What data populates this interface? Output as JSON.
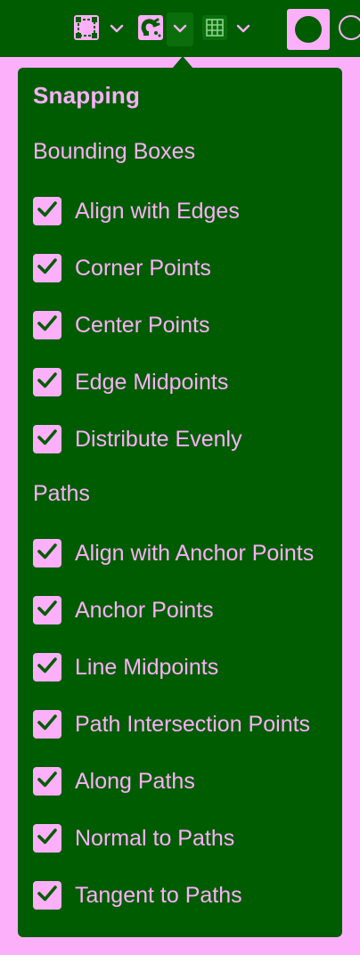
{
  "toolbar": {
    "icons": [
      "bounding-box-snap-icon",
      "magnet-snap-icon",
      "grid-icon"
    ],
    "primary_color": "#005C00",
    "secondary_color": "#FDB0FA"
  },
  "panel": {
    "title": "Snapping",
    "sections": [
      {
        "label": "Bounding Boxes",
        "items": [
          {
            "label": "Align with Edges",
            "checked": true
          },
          {
            "label": "Corner Points",
            "checked": true
          },
          {
            "label": "Center Points",
            "checked": true
          },
          {
            "label": "Edge Midpoints",
            "checked": true
          },
          {
            "label": "Distribute Evenly",
            "checked": true
          }
        ]
      },
      {
        "label": "Paths",
        "items": [
          {
            "label": "Align with Anchor Points",
            "checked": true
          },
          {
            "label": "Anchor Points",
            "checked": true
          },
          {
            "label": "Line Midpoints",
            "checked": true
          },
          {
            "label": "Path Intersection Points",
            "checked": true
          },
          {
            "label": "Along Paths",
            "checked": true
          },
          {
            "label": "Normal to Paths",
            "checked": true
          },
          {
            "label": "Tangent to Paths",
            "checked": true
          }
        ]
      }
    ]
  }
}
